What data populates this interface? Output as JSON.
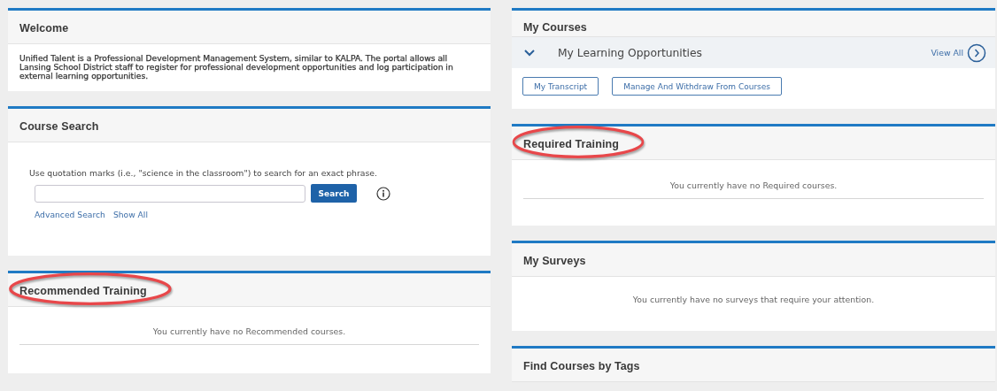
{
  "columns": [
    {
      "panels": [
        {
          "kind": "text",
          "title": "Welcome",
          "annotated": false,
          "text": "Unified Talent is a Professional Development Management System, similar to KALPA. The portal allows all Lansing School District staff to register for professional development opportunities and log participation in external learning opportunities."
        },
        {
          "kind": "search",
          "title": "Course Search",
          "annotated": false,
          "hint": "Use quotation marks (i.e., \"science in the classroom\") to search for an exact phrase.",
          "button": "Search",
          "links": [
            "Advanced Search",
            "Show All"
          ]
        },
        {
          "kind": "empty",
          "title": "Recommended Training",
          "annotated": true,
          "message": "You currently have no Recommended courses.",
          "divider": true
        }
      ]
    },
    {
      "panels": [
        {
          "kind": "courses",
          "title": "My Courses",
          "annotated": false,
          "section": {
            "title": "My Learning Opportunities",
            "expanded": true,
            "view_all": "View All"
          },
          "buttons": [
            "My Transcript",
            "Manage And Withdraw From Courses"
          ]
        },
        {
          "kind": "empty",
          "title": "Required Training",
          "annotated": true,
          "message": "You currently have no Required courses.",
          "divider": true
        },
        {
          "kind": "empty",
          "title": "My Surveys",
          "annotated": false,
          "message": "You currently have no surveys that require your attention.",
          "divider": false
        },
        {
          "kind": "header",
          "title": "Find Courses by Tags",
          "annotated": false
        }
      ]
    }
  ]
}
